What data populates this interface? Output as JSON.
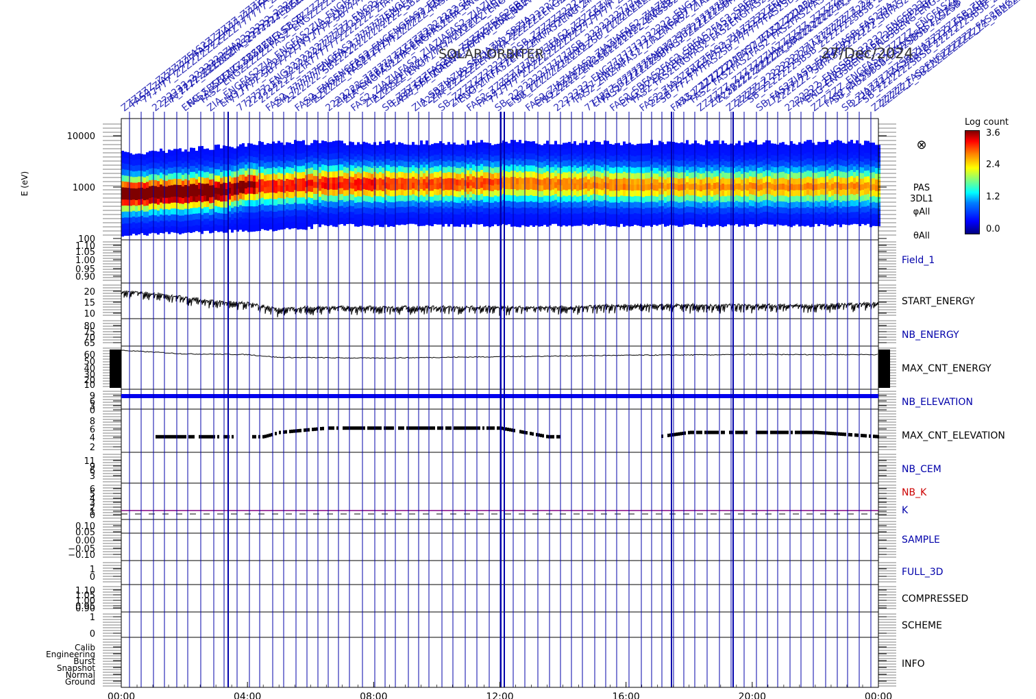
{
  "header": {
    "left": "SOLAR ORBITER",
    "right": "27/Dec/2024"
  },
  "chart_data": {
    "type": "heatmap",
    "time_axis": {
      "ticks": [
        "00:00",
        "04:00",
        "08:00",
        "12:00",
        "16:00",
        "20:00",
        "00:00"
      ],
      "range_hours": [
        0,
        24
      ]
    },
    "event_label_fragments": [
      "FAS2",
      "ENG",
      "ZIA",
      "SB",
      "ZZZZZZ",
      "777777",
      "2222222"
    ],
    "colorbar": {
      "title": "Log count",
      "ticks": [
        "3.6",
        "2.4",
        "1.2",
        "0.0"
      ],
      "range": [
        0,
        3.6
      ]
    },
    "panels": [
      {
        "id": "spectrogram",
        "label_lines": [
          "PAS",
          "3DL1",
          "φAll",
          "θAll"
        ],
        "ylabel": "E (eV)",
        "yticks": [
          "10000",
          "1000",
          "100"
        ],
        "ylog": true,
        "yrange": [
          100,
          15000
        ],
        "icon": "⊗",
        "peak_energy_profile": [
          [
            0,
            650
          ],
          [
            2,
            700
          ],
          [
            3.3,
            750
          ],
          [
            4,
            950
          ],
          [
            5,
            900
          ],
          [
            6,
            1000
          ],
          [
            8,
            1000
          ],
          [
            10,
            1000
          ],
          [
            12,
            1050
          ],
          [
            14,
            1000
          ],
          [
            16,
            950
          ],
          [
            18,
            900
          ],
          [
            20,
            900
          ],
          [
            22,
            900
          ],
          [
            24,
            900
          ]
        ]
      },
      {
        "id": "field_1",
        "label": "Field_1",
        "label_color": "#0000aa",
        "yticks": [
          "1.10",
          "1.05",
          "1.00",
          "0.95",
          "0.90"
        ]
      },
      {
        "id": "start_energy",
        "label": "START_ENERGY",
        "label_color": "#000000",
        "yticks": [
          "20",
          "15",
          "10"
        ],
        "series": [
          [
            0,
            20
          ],
          [
            1,
            19
          ],
          [
            2,
            17
          ],
          [
            3,
            15
          ],
          [
            4,
            14
          ],
          [
            5,
            11
          ],
          [
            6,
            12
          ],
          [
            8,
            12
          ],
          [
            10,
            12
          ],
          [
            12,
            12
          ],
          [
            14,
            12
          ],
          [
            16,
            13
          ],
          [
            18,
            13
          ],
          [
            20,
            13
          ],
          [
            22,
            13
          ],
          [
            24,
            14
          ]
        ]
      },
      {
        "id": "nb_energy",
        "label": "NB_ENERGY",
        "label_color": "#0000aa",
        "yticks": [
          "80",
          "75",
          "70",
          "65"
        ]
      },
      {
        "id": "max_cnt_energy",
        "label": "MAX_CNT_ENERGY",
        "label_color": "#000000",
        "yticks": [
          "60",
          "50",
          "40",
          "30",
          "20",
          "10"
        ],
        "series": [
          [
            0,
            60
          ],
          [
            2,
            55
          ],
          [
            4,
            54
          ],
          [
            5,
            50
          ],
          [
            8,
            49
          ],
          [
            12,
            51
          ],
          [
            16,
            53
          ],
          [
            20,
            54
          ],
          [
            24,
            54
          ]
        ]
      },
      {
        "id": "nb_elevation",
        "label": "NB_ELEVATION",
        "label_color": "#0000aa",
        "yticks": [
          "9",
          "6",
          "3",
          "0"
        ],
        "value": 9
      },
      {
        "id": "max_cnt_elevation",
        "label": "MAX_CNT_ELEVATION",
        "label_color": "#000000",
        "yticks": [
          "8",
          "6",
          "4",
          "2"
        ],
        "series": [
          [
            1,
            4
          ],
          [
            3,
            4
          ],
          [
            4.5,
            4
          ],
          [
            5,
            5
          ],
          [
            6.5,
            6
          ],
          [
            12,
            6
          ],
          [
            13.5,
            4
          ],
          [
            17,
            4
          ],
          [
            18,
            5
          ],
          [
            22,
            5
          ],
          [
            24,
            4
          ]
        ]
      },
      {
        "id": "nb_cem",
        "label": "NB_CEM",
        "label_color": "#0000aa",
        "yticks": [
          "11",
          "9",
          "6",
          "3"
        ]
      },
      {
        "id": "nb_k",
        "label": "NB_K",
        "label_color": "#cc0000",
        "label2": "K",
        "label2_color": "#0000aa",
        "yticks": [
          "6",
          "5",
          "4",
          "3",
          "2",
          "1",
          "0"
        ],
        "value": 1
      },
      {
        "id": "sample",
        "label": "SAMPLE",
        "label_color": "#0000aa",
        "yticks": [
          "0.10",
          "0.05",
          "0.00",
          "−0.05",
          "−0.10"
        ]
      },
      {
        "id": "full_3d",
        "label": "FULL_3D",
        "label_color": "#0000aa",
        "yticks": [
          "1",
          "0"
        ]
      },
      {
        "id": "compressed",
        "label": "COMPRESSED",
        "label_color": "#000000",
        "yticks": [
          "1.10",
          "1.05",
          "1.00",
          "0.95",
          "0.90"
        ]
      },
      {
        "id": "scheme",
        "label": "SCHEME",
        "label_color": "#000000",
        "yticks": [
          "1",
          "0"
        ]
      },
      {
        "id": "info",
        "label": "INFO",
        "label_color": "#000000",
        "yticks": [
          "Calib",
          "Engineering",
          "Burst",
          "Snapshot",
          "Normal",
          "Ground"
        ]
      }
    ]
  },
  "colors": {
    "vline": "#0000aa",
    "nb_elevation": "#0000ee",
    "nb_k": "#800080",
    "label_blue": "#0000aa"
  }
}
